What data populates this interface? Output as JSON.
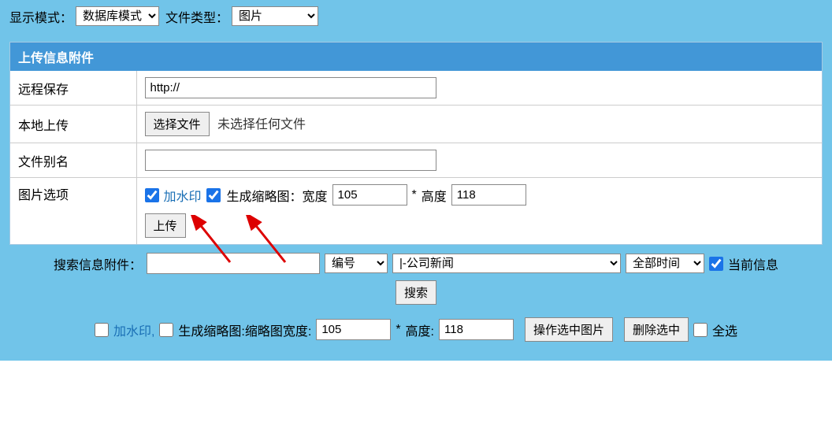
{
  "topbar": {
    "displayModeLabel": "显示模式：",
    "displayModeValue": "数据库模式",
    "fileTypeLabel": "文件类型：",
    "fileTypeValue": "图片"
  },
  "panel": {
    "title": "上传信息附件",
    "rows": {
      "remoteSave": "远程保存",
      "remoteUrl": "http://",
      "localUpload": "本地上传",
      "chooseFile": "选择文件",
      "noFileChosen": "未选择任何文件",
      "fileAlias": "文件别名",
      "imageOptions": "图片选项",
      "watermark": "加水印",
      "genThumb": "生成缩略图：宽度",
      "widthVal": "105",
      "star": "*",
      "heightLabel": "高度",
      "heightVal": "118",
      "uploadBtn": "上传"
    }
  },
  "search": {
    "label": "搜索信息附件：",
    "searchFieldValue": "",
    "numberSelect": "编号",
    "categorySelect": "|-公司新闻",
    "timeSelect": "全部时间",
    "currentInfo": "当前信息",
    "searchBtn": "搜索"
  },
  "filter": {
    "watermark": "加水印,",
    "genThumbPrefix": "生成缩略图:缩略图宽度:",
    "widthVal": "105",
    "star": "*",
    "heightLabel": "高度:",
    "heightVal": "118",
    "opBtn": "操作选中图片",
    "deleteBtn": "删除选中",
    "selectAll": "全选"
  }
}
